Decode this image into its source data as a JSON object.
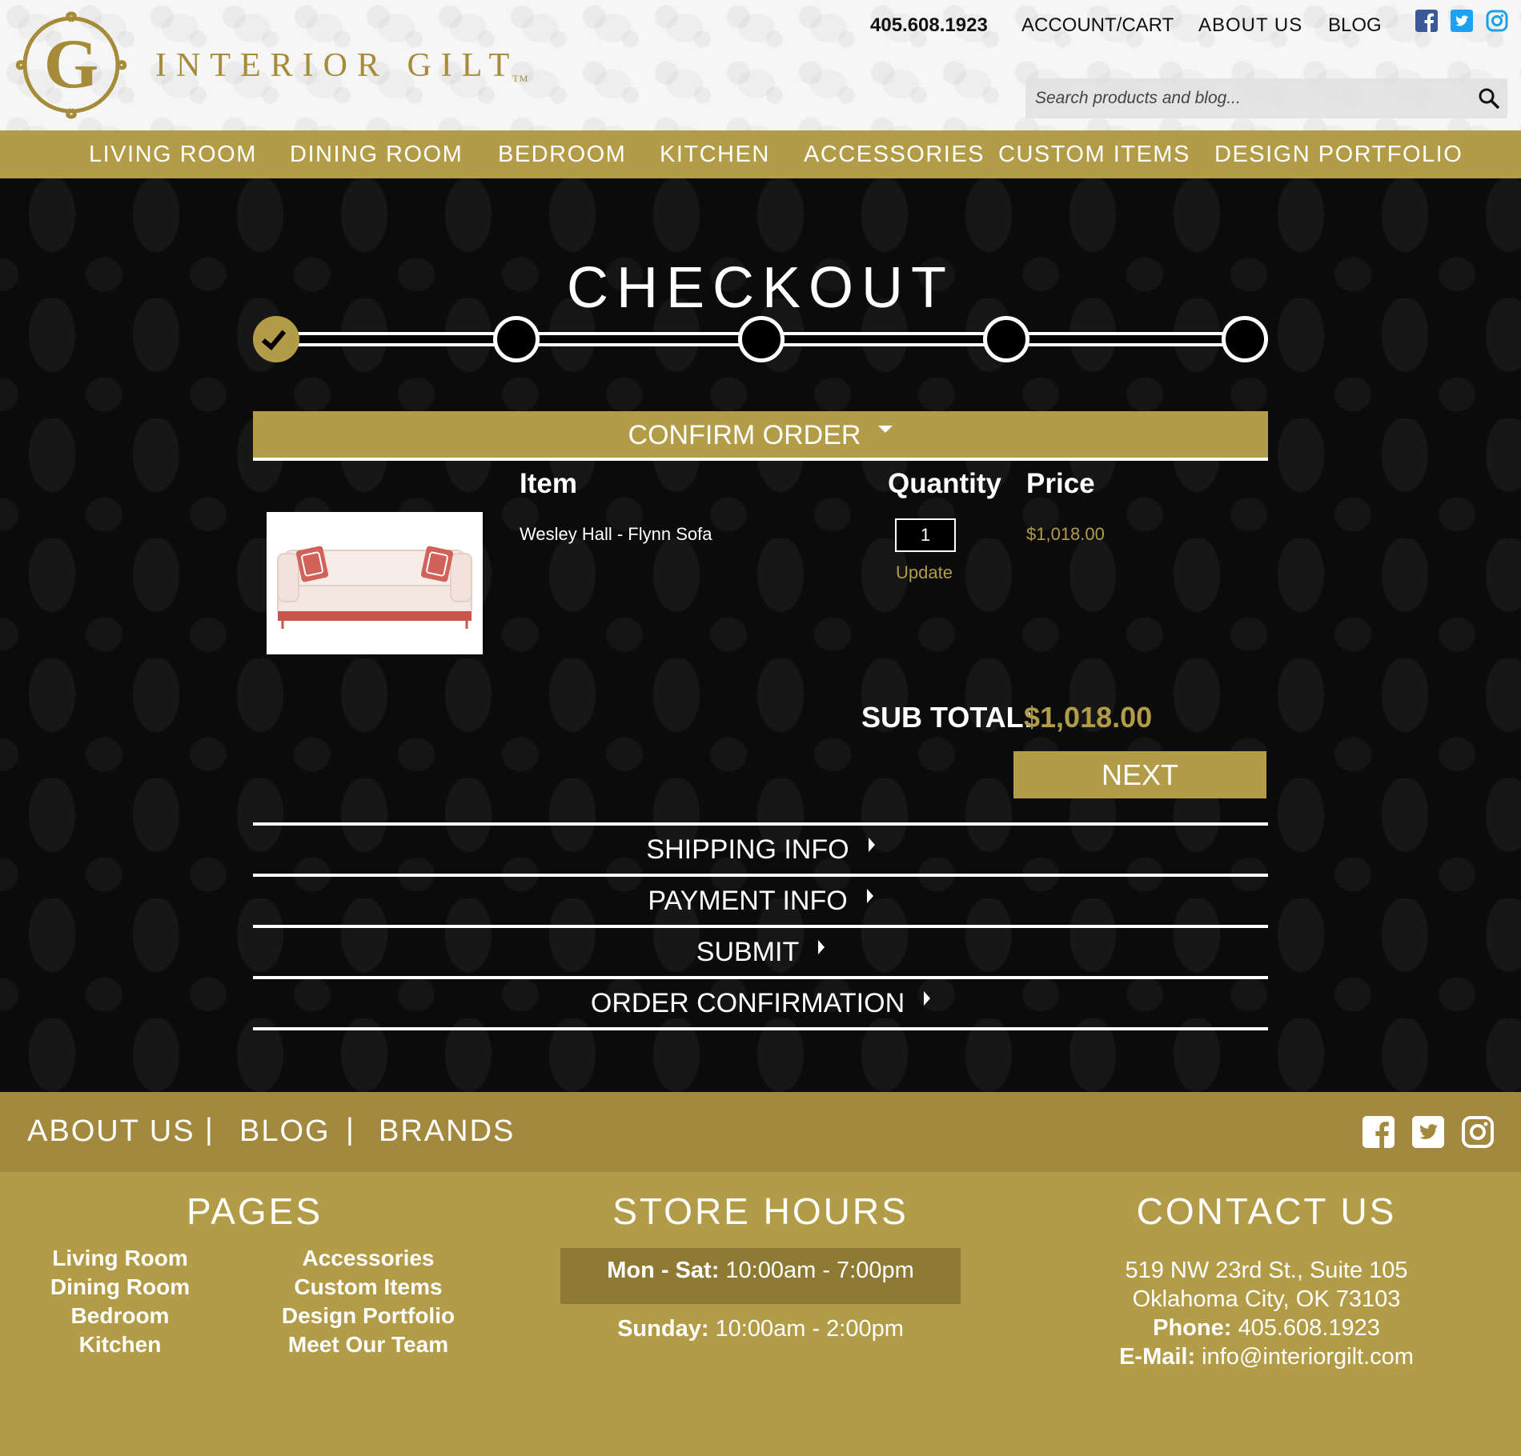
{
  "header": {
    "logo_text": "INTERIOR GILT",
    "logo_tm": "TM",
    "phone": "405.608.1923",
    "links": [
      "ACCOUNT/CART",
      "ABOUT US",
      "BLOG"
    ],
    "social_icons": [
      "facebook-icon",
      "twitter-icon",
      "instagram-icon"
    ],
    "search_placeholder": "Search products and blog..."
  },
  "nav": [
    "LIVING ROOM",
    "DINING ROOM",
    "BEDROOM",
    "KITCHEN",
    "ACCESSORIES",
    "CUSTOM ITEMS",
    "DESIGN PORTFOLIO"
  ],
  "checkout": {
    "title": "CHECKOUT",
    "progress": {
      "total_steps": 5,
      "completed_steps": 1
    },
    "active_section": "CONFIRM ORDER",
    "columns": {
      "item": "Item",
      "quantity": "Quantity",
      "price": "Price"
    },
    "items": [
      {
        "name": "Wesley Hall - Flynn Sofa",
        "quantity": "1",
        "update_label": "Update",
        "price": "$1,018.00"
      }
    ],
    "subtotal_label": "SUB TOTAL:",
    "subtotal_value": "$1,018.00",
    "next_label": "NEXT",
    "collapsed_sections": [
      "SHIPPING INFO",
      "PAYMENT INFO",
      "SUBMIT",
      "ORDER CONFIRMATION"
    ]
  },
  "footer": {
    "top_links": [
      "ABOUT US",
      "BLOG",
      "BRANDS"
    ],
    "separator": "|",
    "pages_heading": "PAGES",
    "pages_col1": [
      "Living Room",
      "Dining Room",
      "Bedroom",
      "Kitchen"
    ],
    "pages_col2": [
      "Accessories",
      "Custom Items",
      "Design Portfolio",
      "Meet Our Team"
    ],
    "hours_heading": "STORE HOURS",
    "hours": [
      {
        "day": "Mon - Sat:",
        "time": " 10:00am - 7:00pm"
      },
      {
        "day": "Sunday:",
        "time": " 10:00am - 2:00pm"
      }
    ],
    "contact_heading": "CONTACT US",
    "address_line1": "519 NW 23rd St., Suite 105",
    "address_line2": "Oklahoma City, OK 73103",
    "phone_label": "Phone:",
    "phone_value": " 405.608.1923",
    "email_label": "E-Mail:",
    "email_value": " info@interiorgilt.com"
  },
  "colors": {
    "gold": "#b39c47",
    "dark_gold": "#a3893e",
    "black": "#000000",
    "white": "#ffffff"
  }
}
